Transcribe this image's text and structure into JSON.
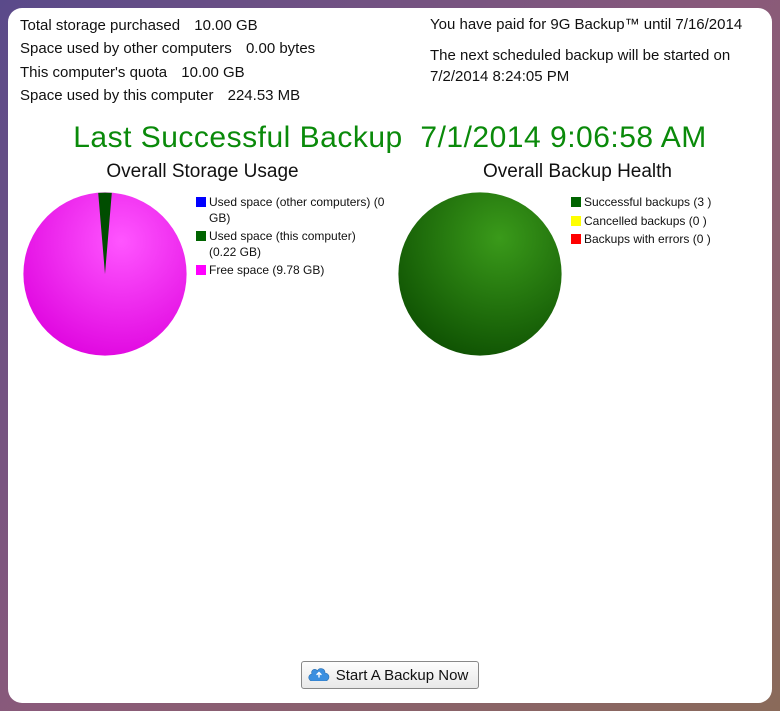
{
  "stats": {
    "total_storage_label": "Total storage purchased",
    "total_storage_value": "10.00 GB",
    "other_space_label": "Space used by other computers",
    "other_space_value": "0.00 bytes",
    "quota_label": "This computer's quota",
    "quota_value": "10.00 GB",
    "this_space_label": "Space used by this computer",
    "this_space_value": "224.53 MB"
  },
  "subscription": {
    "paid_text": "You have paid for 9G Backup™ until 7/16/2014",
    "next_text": "The next scheduled backup will be started on 7/2/2014 8:24:05 PM"
  },
  "last_backup": {
    "prefix": "Last Successful Backup",
    "timestamp": "7/1/2014 9:06:58 AM"
  },
  "storage_chart": {
    "title": "Overall Storage Usage",
    "legend": [
      {
        "color": "#0000ff",
        "label": "Used space (other computers) (0 GB)"
      },
      {
        "color": "#006400",
        "label": "Used space (this computer) (0.22 GB)"
      },
      {
        "color": "#ff00ff",
        "label": "Free space (9.78 GB)"
      }
    ]
  },
  "health_chart": {
    "title": "Overall Backup Health",
    "legend": [
      {
        "color": "#006400",
        "label": "Successful backups (3 )"
      },
      {
        "color": "#ffff00",
        "label": "Cancelled backups (0 )"
      },
      {
        "color": "#ff0000",
        "label": "Backups with errors (0 )"
      }
    ]
  },
  "button": {
    "label": "Start A Backup Now"
  },
  "chart_data": [
    {
      "type": "pie",
      "title": "Overall Storage Usage",
      "categories": [
        "Used space (other computers)",
        "Used space (this computer)",
        "Free space"
      ],
      "values": [
        0,
        0.22,
        9.78
      ],
      "unit": "GB",
      "colors": [
        "#0000ff",
        "#006400",
        "#ff00ff"
      ]
    },
    {
      "type": "pie",
      "title": "Overall Backup Health",
      "categories": [
        "Successful backups",
        "Cancelled backups",
        "Backups with errors"
      ],
      "values": [
        3,
        0,
        0
      ],
      "colors": [
        "#006400",
        "#ffff00",
        "#ff0000"
      ]
    }
  ]
}
